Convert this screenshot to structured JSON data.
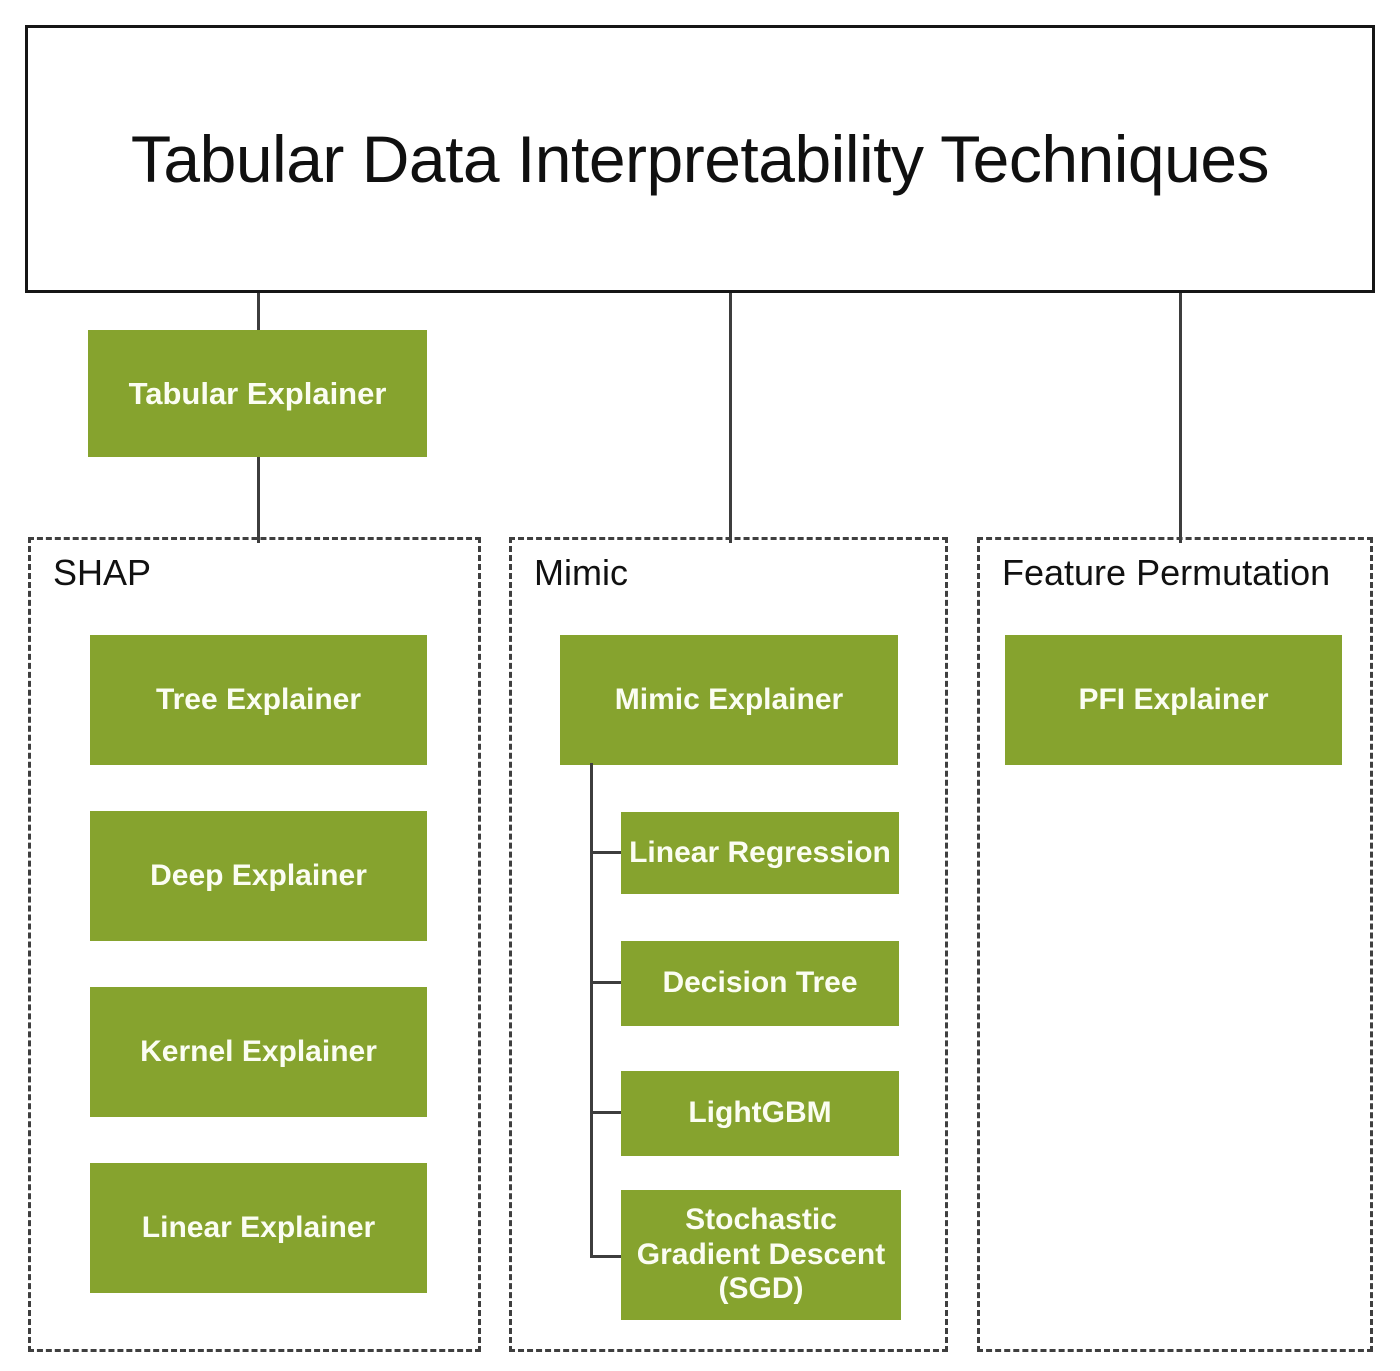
{
  "diagram": {
    "title": "Tabular Data Interpretability Techniques",
    "accent_color": "#86a32e",
    "node_text_color": "#fbfdf2",
    "border_color": "#161616",
    "connector_color": "#3d3d3d",
    "group_border_color": "#3f3f3f"
  },
  "root_node": {
    "label": "Tabular Explainer"
  },
  "groups": [
    {
      "label": "SHAP",
      "nodes": [
        {
          "label": "Tree Explainer"
        },
        {
          "label": "Deep Explainer"
        },
        {
          "label": "Kernel Explainer"
        },
        {
          "label": "Linear Explainer"
        }
      ]
    },
    {
      "label": "Mimic",
      "nodes": [
        {
          "label": "Mimic Explainer"
        }
      ],
      "children": [
        {
          "label": "Linear Regression"
        },
        {
          "label": "Decision Tree"
        },
        {
          "label": "LightGBM"
        },
        {
          "label": "Stochastic Gradient Descent (SGD)",
          "lines": [
            "Stochastic",
            "Gradient Descent",
            "(SGD)"
          ]
        }
      ]
    },
    {
      "label": "Feature Permutation",
      "nodes": [
        {
          "label": "PFI Explainer"
        }
      ]
    }
  ],
  "sgd_lines": {
    "line1": "Stochastic",
    "line2": "Gradient Descent",
    "line3": "(SGD)"
  }
}
